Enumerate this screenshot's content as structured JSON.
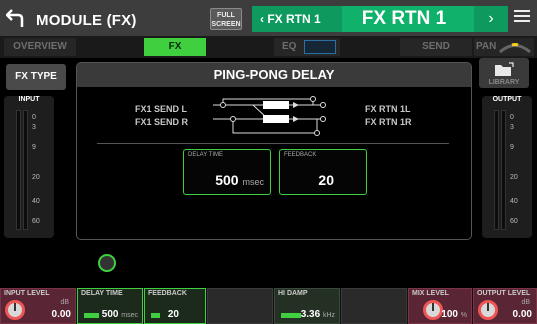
{
  "header": {
    "title": "MODULE (FX)",
    "full_screen": "FULL SCREEN",
    "prev_label": "FX RTN 1",
    "current_label": "FX RTN 1",
    "next_symbol": "›",
    "back_symbol": "↰"
  },
  "tabs": {
    "overview": "OVERVIEW",
    "fx": "FX",
    "eq": "EQ",
    "send": "SEND",
    "pan": "PAN"
  },
  "fx_type_button": "FX TYPE",
  "library_button": "LIBRARY",
  "meters": {
    "input_title": "INPUT",
    "output_title": "OUTPUT",
    "ticks": [
      "0",
      "3",
      "9",
      "20",
      "40",
      "60"
    ]
  },
  "fx": {
    "name": "PING-PONG DELAY",
    "send_l": "FX1 SEND L",
    "send_r": "FX1 SEND R",
    "rtn_l": "FX RTN 1L",
    "rtn_r": "FX RTN 1R",
    "delay_time": {
      "label": "DELAY TIME",
      "value": "500",
      "unit": "msec"
    },
    "feedback": {
      "label": "FEEDBACK",
      "value": "20"
    }
  },
  "strip": {
    "input_level": {
      "label": "INPUT LEVEL",
      "unit": "dB",
      "value": "0.00"
    },
    "delay_time": {
      "label": "DELAY TIME",
      "value": "500",
      "unit": "msec",
      "level": 0.35
    },
    "feedback": {
      "label": "FEEDBACK",
      "value": "20",
      "level": 0.2
    },
    "hi_damp": {
      "label": "HI DAMP",
      "value": "3.36",
      "unit": "kHz",
      "level": 0.45
    },
    "mix_level": {
      "label": "MIX LEVEL",
      "value": "100",
      "unit": "%"
    },
    "output_level": {
      "label": "OUTPUT LEVEL",
      "unit": "dB",
      "value": "0.00"
    }
  },
  "colors": {
    "accent_green": "#3fcf3f",
    "header_green": "#10b26b",
    "panel_gray": "#3a3a3a",
    "pink_slot": "#5a2534"
  }
}
